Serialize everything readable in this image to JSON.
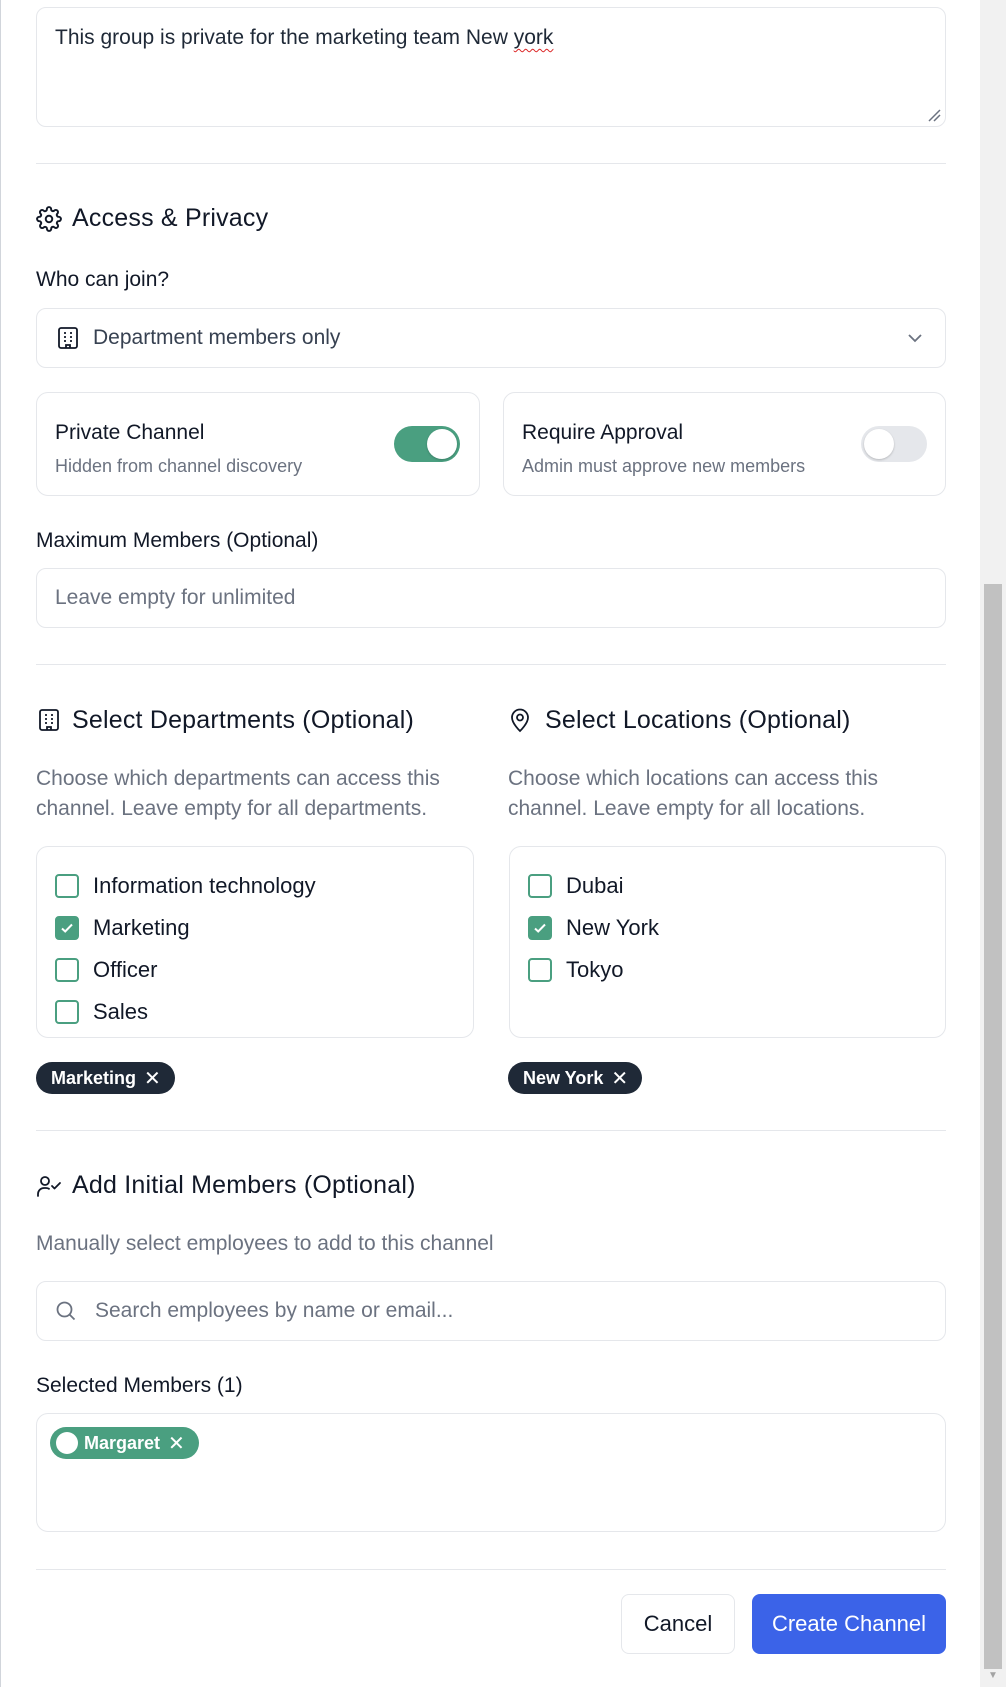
{
  "description_field": {
    "value_prefix": "This group is private for the marketing team New ",
    "value_misspelled": "york"
  },
  "access_privacy": {
    "title": "Access & Privacy",
    "icon": "gear-icon",
    "who_can_join_label": "Who can join?",
    "who_can_join_value": "Department members only",
    "private_channel": {
      "title": "Private Channel",
      "subtitle": "Hidden from channel discovery",
      "enabled": true
    },
    "require_approval": {
      "title": "Require Approval",
      "subtitle": "Admin must approve new members",
      "enabled": false
    },
    "max_members_label": "Maximum Members (Optional)",
    "max_members_placeholder": "Leave empty for unlimited"
  },
  "departments": {
    "title": "Select Departments (Optional)",
    "description": "Choose which departments can access this channel. Leave empty for all departments.",
    "options": [
      {
        "label": "Information technology",
        "checked": false
      },
      {
        "label": "Marketing",
        "checked": true
      },
      {
        "label": "Officer",
        "checked": false
      },
      {
        "label": "Sales",
        "checked": false
      }
    ],
    "selected_chips": [
      "Marketing"
    ]
  },
  "locations": {
    "title": "Select Locations (Optional)",
    "description": "Choose which locations can access this channel. Leave empty for all locations.",
    "options": [
      {
        "label": "Dubai",
        "checked": false
      },
      {
        "label": "New York",
        "checked": true
      },
      {
        "label": "Tokyo",
        "checked": false
      }
    ],
    "selected_chips": [
      "New York"
    ]
  },
  "members": {
    "title": "Add Initial Members (Optional)",
    "description": "Manually select employees to add to this channel",
    "search_placeholder": "Search employees by name or email...",
    "selected_label": "Selected Members (1)",
    "selected": [
      "Margaret"
    ]
  },
  "actions": {
    "cancel": "Cancel",
    "create": "Create Channel"
  },
  "colors": {
    "accent_green": "#4a9f80",
    "primary_blue": "#3b63e8",
    "chip_dark": "#1f2937"
  }
}
